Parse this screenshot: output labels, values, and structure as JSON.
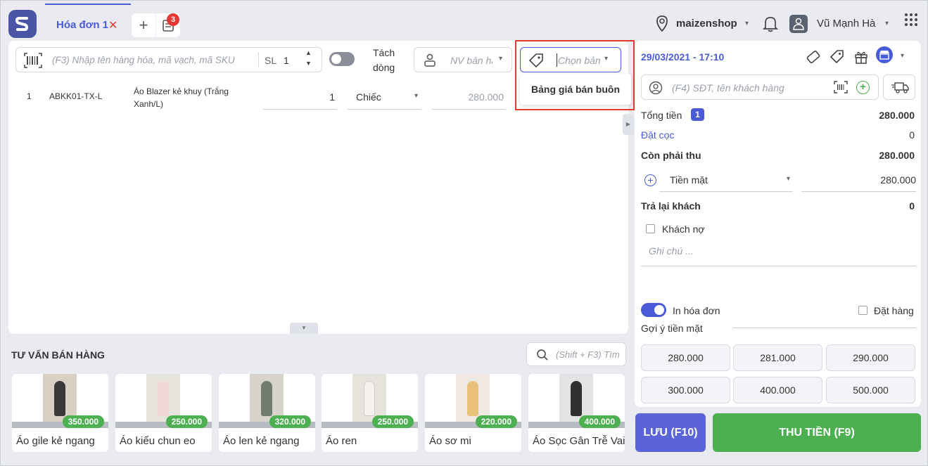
{
  "tabs": {
    "invoice_tab": "Hóa đơn 1",
    "close_glyph": "✕",
    "add_glyph": "+",
    "cart_count": "3"
  },
  "header": {
    "shop_name": "maizenshop",
    "user_name": "Vũ Mạnh Hà"
  },
  "search": {
    "placeholder": "(F3) Nhập tên hàng hóa, mã vạch, mã SKU",
    "qty_label": "SL",
    "qty_value": "1"
  },
  "split_line": {
    "label_line1": "Tách",
    "label_line2": "dòng"
  },
  "staff": {
    "placeholder": "NV bán hà"
  },
  "price_select": {
    "placeholder": "Chọn bản",
    "option_wholesale": "Bảng giá bán buôn"
  },
  "line_items": [
    {
      "index": "1",
      "sku": "ABKK01-TX-L",
      "name": "Áo Blazer kẻ khuy (Trắng Xanh/L)",
      "qty": "1",
      "unit": "Chiếc",
      "price": "280.000"
    }
  ],
  "advice": {
    "title": "TƯ VẤN BÁN HÀNG",
    "search_placeholder": "(Shift + F3) Tìm"
  },
  "products": [
    {
      "name": "Áo gile kẻ ngang",
      "price": "350.000",
      "color": "#3b3838"
    },
    {
      "name": "Áo kiểu chun eo",
      "price": "250.000",
      "color": "#f2d7d4"
    },
    {
      "name": "Áo len kẻ ngang",
      "price": "320.000",
      "color": "#6e7d70"
    },
    {
      "name": "Áo ren",
      "price": "250.000",
      "color": "#f4f1ee"
    },
    {
      "name": "Áo sơ mi",
      "price": "220.000",
      "color": "#e8c27a"
    },
    {
      "name": "Áo Sọc Gân Trễ Vai",
      "price": "400.000",
      "color": "#2f3030"
    }
  ],
  "summary": {
    "datetime": "29/03/2021 - 17:10",
    "customer_placeholder": "(F4) SĐT, tên khách hàng",
    "total_label": "Tổng tiền",
    "total_count": "1",
    "total_value": "280.000",
    "deposit_label": "Đặt cọc",
    "deposit_value": "0",
    "remaining_label": "Còn phải thu",
    "remaining_value": "280.000",
    "payment_method": "Tiền mặt",
    "payment_value": "280.000",
    "change_label": "Trả lại khách",
    "change_value": "0",
    "debt_label": "Khách nợ",
    "note_placeholder": "Ghi chú ...",
    "print_label": "In hóa đơn",
    "order_label": "Đặt hàng",
    "cash_suggest_label": "Gợi ý tiền mặt",
    "cash_suggestions": [
      "280.000",
      "281.000",
      "290.000",
      "300.000",
      "400.000",
      "500.000"
    ]
  },
  "actions": {
    "save_label": "LƯU (F10)",
    "pay_label": "THU TIỀN (F9)"
  },
  "colors": {
    "accent": "#4a5bd8",
    "success": "#4caf50",
    "highlight_border": "#e53935"
  }
}
